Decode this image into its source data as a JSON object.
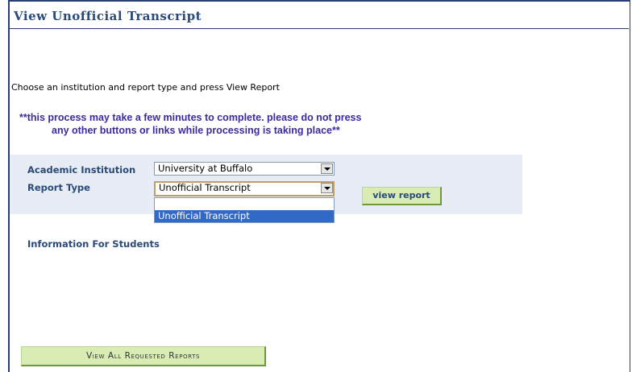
{
  "page": {
    "title": "View Unofficial Transcript",
    "instructions": "Choose an institution and report type and press View Report",
    "warning_line1": "**this process may take a few minutes to complete. please do not press",
    "warning_line2": "any other buttons or links while processing is taking place**"
  },
  "form": {
    "institution_label": "Academic Institution",
    "institution_value": "University at Buffalo",
    "report_type_label": "Report Type",
    "report_type_value": "Unofficial Transcript",
    "dropdown_options": [
      "",
      "Unofficial Transcript"
    ],
    "view_report_button": "view report"
  },
  "links": {
    "info_for_students": "Information For Students"
  },
  "footer": {
    "view_all_button": "View All Requested Reports"
  }
}
